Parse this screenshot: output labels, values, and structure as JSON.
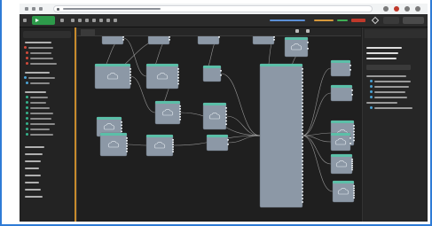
{
  "colors": {
    "frame_accent": "#2e7bd6",
    "node_header": "#5bbfa8",
    "canvas_bg": "#1f1f1f",
    "node_body": "#8c98a6",
    "wire": "#c8c8c8",
    "deploy_status_error": "#c0392b",
    "scroll_accent": "#c78a2c"
  },
  "icons": {
    "browser_back": "back-icon",
    "browser_forward": "forward-icon",
    "browser_reload": "reload-icon",
    "lock": "lock-icon",
    "extensions": "extension-icon",
    "run": "play-icon",
    "edit": "pencil-icon",
    "node_function": "cloud-icon"
  }
}
